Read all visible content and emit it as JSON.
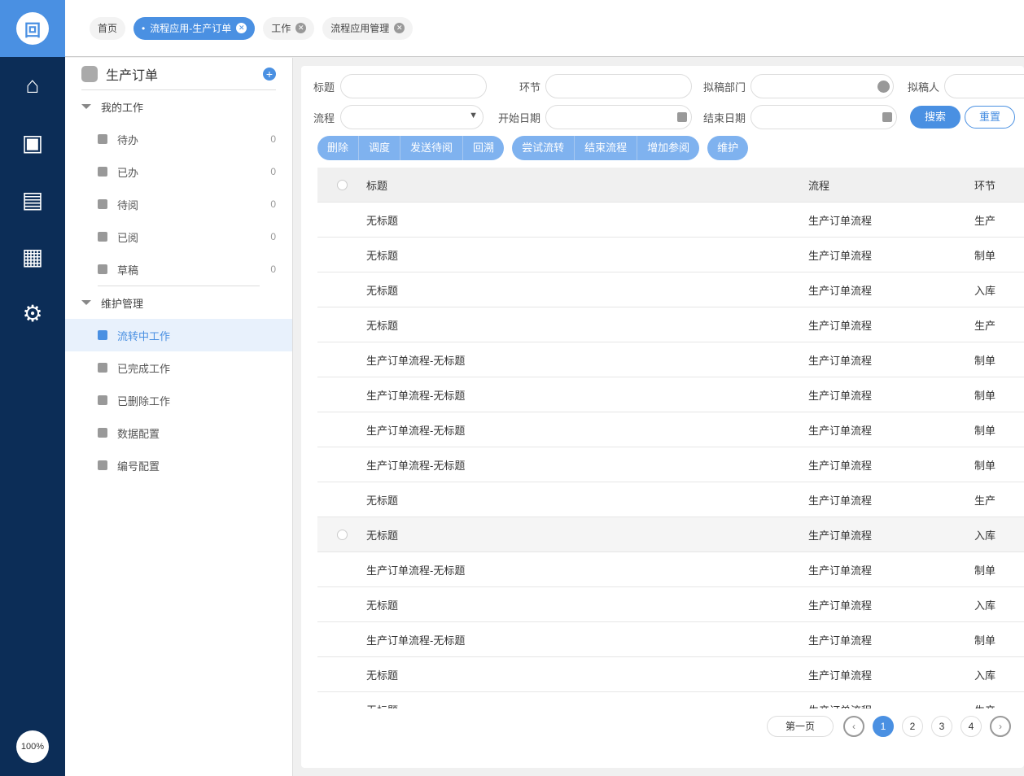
{
  "rail": {
    "zoom": "100%",
    "icons": [
      "home-icon",
      "user-monitor-icon",
      "news-icon",
      "calendar-icon",
      "user-settings-icon"
    ]
  },
  "tabs": [
    {
      "label": "首页"
    },
    {
      "label": "流程应用-生产订单",
      "active": true
    },
    {
      "label": "工作"
    },
    {
      "label": "流程应用管理"
    }
  ],
  "sidebar": {
    "title": "生产订单",
    "groups": [
      {
        "label": "我的工作",
        "items": [
          {
            "label": "待办",
            "count": "0"
          },
          {
            "label": "已办",
            "count": "0"
          },
          {
            "label": "待阅",
            "count": "0"
          },
          {
            "label": "已阅",
            "count": "0"
          },
          {
            "label": "草稿",
            "count": "0"
          }
        ]
      },
      {
        "label": "维护管理",
        "items": [
          {
            "label": "流转中工作",
            "selected": true
          },
          {
            "label": "已完成工作"
          },
          {
            "label": "已删除工作"
          },
          {
            "label": "数据配置"
          },
          {
            "label": "编号配置"
          }
        ]
      }
    ]
  },
  "filters": {
    "title": "标题",
    "node": "环节",
    "dept": "拟稿部门",
    "drafter": "拟稿人",
    "process": "流程",
    "start": "开始日期",
    "end": "结束日期",
    "search": "搜索",
    "reset": "重置"
  },
  "actions": [
    [
      "删除",
      "调度",
      "发送待阅",
      "回溯"
    ],
    [
      "尝试流转",
      "结束流程",
      "增加参阅"
    ],
    [
      "维护"
    ]
  ],
  "table": {
    "headers": [
      "标题",
      "流程",
      "环节"
    ],
    "rows": [
      [
        "无标题",
        "生产订单流程",
        "生产"
      ],
      [
        "无标题",
        "生产订单流程",
        "制单"
      ],
      [
        "无标题",
        "生产订单流程",
        "入库"
      ],
      [
        "无标题",
        "生产订单流程",
        "生产"
      ],
      [
        "生产订单流程-无标题",
        "生产订单流程",
        "制单"
      ],
      [
        "生产订单流程-无标题",
        "生产订单流程",
        "制单"
      ],
      [
        "生产订单流程-无标题",
        "生产订单流程",
        "制单"
      ],
      [
        "生产订单流程-无标题",
        "生产订单流程",
        "制单"
      ],
      [
        "无标题",
        "生产订单流程",
        "生产"
      ],
      [
        "无标题",
        "生产订单流程",
        "入库"
      ],
      [
        "生产订单流程-无标题",
        "生产订单流程",
        "制单"
      ],
      [
        "无标题",
        "生产订单流程",
        "入库"
      ],
      [
        "生产订单流程-无标题",
        "生产订单流程",
        "制单"
      ],
      [
        "无标题",
        "生产订单流程",
        "入库"
      ],
      [
        "无标题",
        "生产订单流程",
        "生产"
      ]
    ]
  },
  "pagination": {
    "first": "第一页",
    "pages": [
      "1",
      "2",
      "3",
      "4"
    ],
    "current": "1"
  }
}
